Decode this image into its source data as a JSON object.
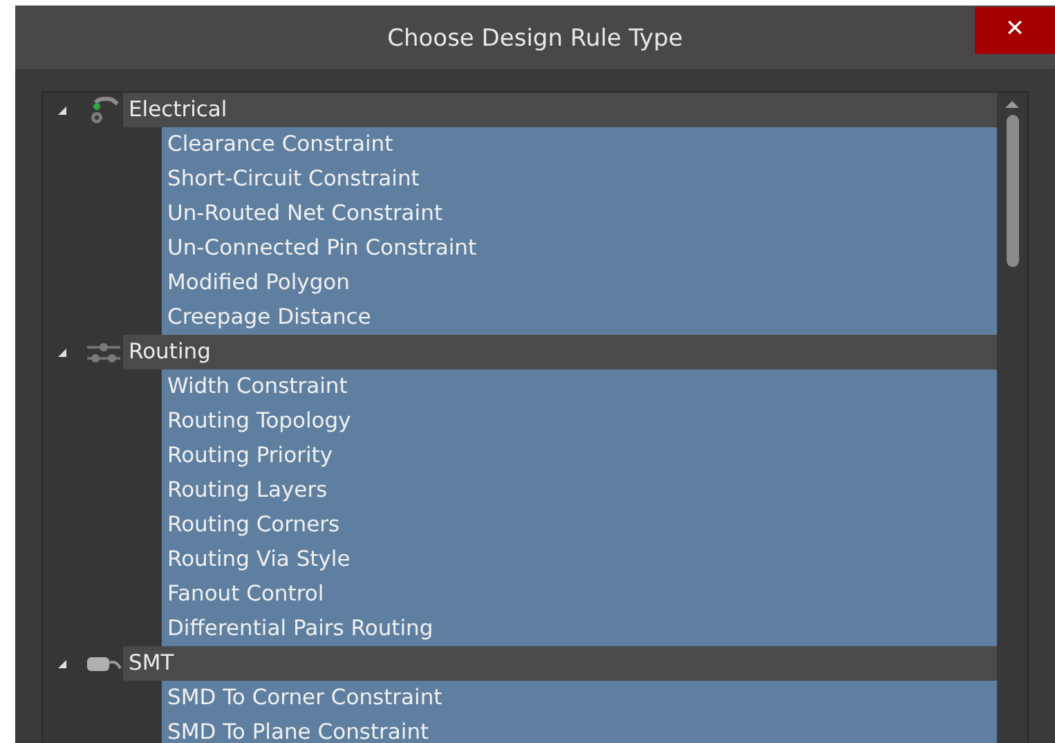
{
  "window": {
    "title": "Choose Design Rule Type",
    "close": "✕"
  },
  "tree": [
    {
      "label": "Electrical",
      "kind": "electrical",
      "expanded": true,
      "children": [
        {
          "label": "Clearance Constraint",
          "selected": true
        },
        {
          "label": "Short-Circuit Constraint",
          "selected": true
        },
        {
          "label": "Un-Routed Net Constraint",
          "selected": true
        },
        {
          "label": "Un-Connected Pin Constraint",
          "selected": true
        },
        {
          "label": "Modified Polygon",
          "selected": true
        },
        {
          "label": "Creepage Distance",
          "selected": true
        }
      ]
    },
    {
      "label": "Routing",
      "kind": "routing",
      "expanded": true,
      "children": [
        {
          "label": "Width Constraint",
          "selected": true
        },
        {
          "label": "Routing Topology",
          "selected": true
        },
        {
          "label": "Routing Priority",
          "selected": true
        },
        {
          "label": "Routing Layers",
          "selected": true
        },
        {
          "label": "Routing Corners",
          "selected": true
        },
        {
          "label": "Routing Via Style",
          "selected": true
        },
        {
          "label": "Fanout Control",
          "selected": true
        },
        {
          "label": "Differential Pairs Routing",
          "selected": true
        }
      ]
    },
    {
      "label": "SMT",
      "kind": "smt",
      "expanded": true,
      "children": [
        {
          "label": "SMD To Corner Constraint",
          "selected": true
        },
        {
          "label": "SMD To Plane Constraint",
          "selected": true
        }
      ]
    }
  ]
}
